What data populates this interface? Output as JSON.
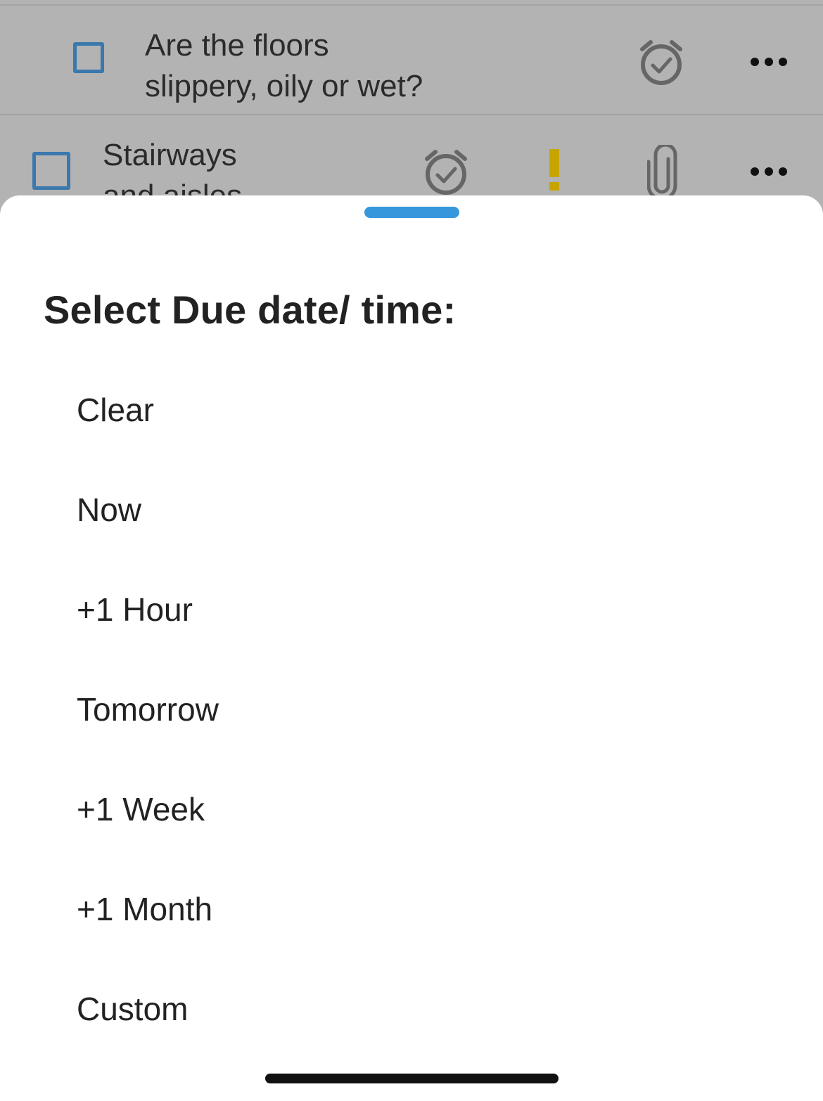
{
  "background_rows": [
    {
      "text": "Are the floors slippery, oily or wet?",
      "line1": "Are the floors",
      "line2": "slippery, oily or wet?",
      "icons": [
        "checkbox-icon",
        "alarm-check-icon",
        "more-icon"
      ]
    },
    {
      "text": "Stairways and aisles",
      "line1": "Stairways",
      "line2": "and aisles",
      "icons": [
        "checkbox-icon",
        "alarm-check-icon",
        "priority-icon",
        "attachment-icon",
        "more-icon"
      ]
    }
  ],
  "sheet": {
    "title": "Select Due date/ time:",
    "options": [
      {
        "label": "Clear"
      },
      {
        "label": "Now"
      },
      {
        "label": "+1 Hour"
      },
      {
        "label": "Tomorrow"
      },
      {
        "label": "+1 Week"
      },
      {
        "label": "+1 Month"
      },
      {
        "label": "Custom"
      }
    ]
  },
  "colors": {
    "accent": "#3797dd",
    "checkbox": "#3a78ad",
    "priority": "#c8a400",
    "overlay": "#b3b3b3"
  }
}
